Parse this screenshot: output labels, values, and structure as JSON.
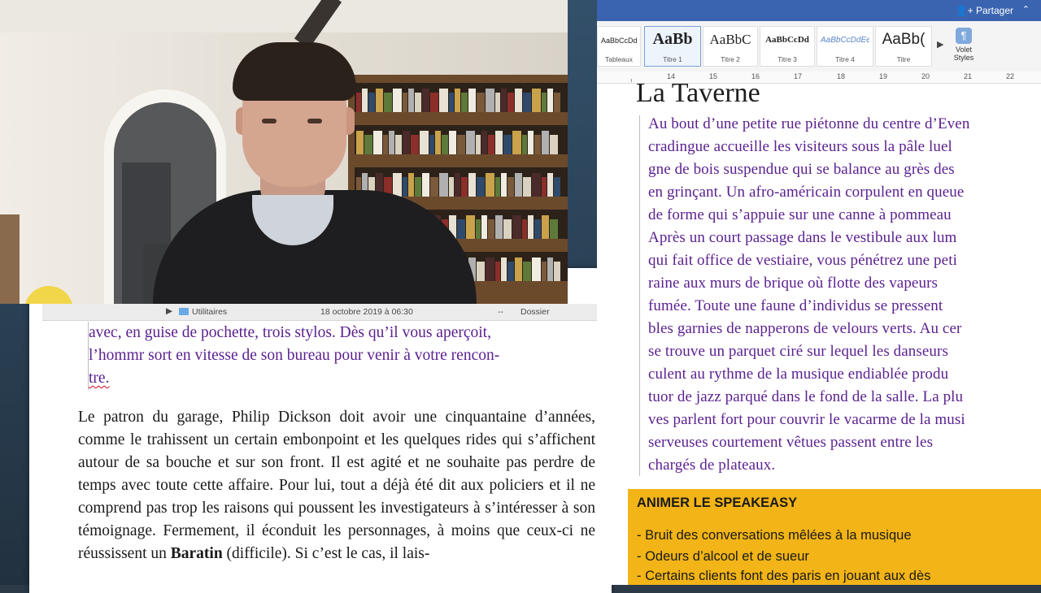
{
  "left_doc": {
    "quote_lines": [
      "avec, en guise de pochette, trois stylos. Dès qu’il vous aperçoit,",
      "l’hommr sort en vitesse de son bureau pour venir à votre rencon-",
      "tre."
    ],
    "body_text": "Le patron du garage, Philip Dickson doit avoir une cinquantaine d’années, comme le trahissent un certain embonpoint et les quelques rides qui s’affichent autour de sa bouche et sur son front. Il est agité et ne souhaite pas perdre de temps avec toute cette affaire. Pour lui, tout a déjà été dit aux policiers et il ne comprend pas trop les raisons qui poussent les investigateurs à s’intéresser à son témoignage. Fermement, il éconduit les personnages, à moins que ceux-ci ne réussissent un",
    "body_bold": "Baratin",
    "body_tail": " (difficile). Si c’est le cas, il lais-"
  },
  "finder": {
    "name": "Utilitaires",
    "date": "18 octobre 2019 à 06:30",
    "size": "--",
    "kind": "Dossier"
  },
  "right_doc": {
    "share_label": "Partager",
    "styles": [
      {
        "preview": "AaBbCcDdEe",
        "label": "Tableaux"
      },
      {
        "preview": "AaBb",
        "label": "Titre 1"
      },
      {
        "preview": "AaBbC",
        "label": "Titre 2"
      },
      {
        "preview": "AaBbCcDd",
        "label": "Titre 3"
      },
      {
        "preview": "AaBbCcDdEe",
        "label": "Titre 4"
      },
      {
        "preview": "AaBb(",
        "label": "Titre"
      }
    ],
    "volet_label": "Volet Styles",
    "ruler_ticks": [
      "14",
      "15",
      "16",
      "17",
      "18",
      "19",
      "20",
      "21",
      "22"
    ],
    "heading": "La Taverne",
    "quote_lines": [
      "Au bout d’une petite rue piétonne du centre d’Even",
      "cradingue accueille les visiteurs sous la pâle luel",
      "gne de bois suspendue qui se balance au grès des",
      "en grinçant. Un afro-américain corpulent en queue",
      "de forme qui s’appuie sur une canne à pommeau",
      "Après un court passage dans le vestibule aux lum",
      "qui fait office de vestiaire, vous pénétrez une peti",
      "raine aux murs de brique où flotte des vapeurs",
      "fumée. Toute une faune d’individus se pressent",
      "bles garnies de napperons de velours verts. Au cer",
      "se trouve un parquet ciré sur lequel les danseurs",
      "culent au rythme de la musique endiablée produ",
      "tuor de jazz parqué dans le fond de la salle. La plu",
      "ves parlent fort pour couvrir le vacarme de la musi",
      "serveuses courtement vêtues passent entre les",
      "chargés de plateaux."
    ],
    "callout_title": "ANIMER LE SPEAKEASY",
    "callout_items": [
      "- Bruit des conversations mêlées à la musique",
      "- Odeurs d’alcool et de sueur",
      "- Certains clients font des paris en jouant aux dès"
    ]
  }
}
